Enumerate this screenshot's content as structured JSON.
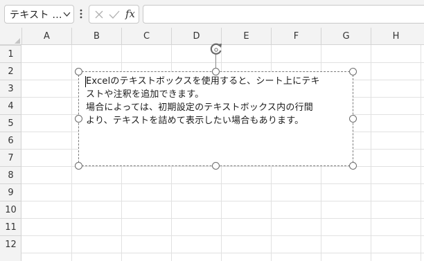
{
  "name_box": {
    "value": "テキスト ..."
  },
  "formula_bar": {
    "fx_label": "fx",
    "value": ""
  },
  "columns": [
    "A",
    "B",
    "C",
    "D",
    "E",
    "F",
    "G",
    "H"
  ],
  "rows": [
    "1",
    "2",
    "3",
    "4",
    "5",
    "6",
    "7",
    "8",
    "9",
    "10",
    "11",
    "12"
  ],
  "text_box": {
    "lines": [
      "Excelのテキストボックスを使用すると、シート上にテキ",
      "ストや注釈を追加できます。",
      "場合によっては、初期設定のテキストボックス内の行間",
      "より、テキストを詰めて表示したい場合もあります。"
    ]
  },
  "colors": {
    "chrome_bg": "#f3f3f3",
    "gridline": "#e1e1e1",
    "handle_border": "#6a6a6a"
  }
}
